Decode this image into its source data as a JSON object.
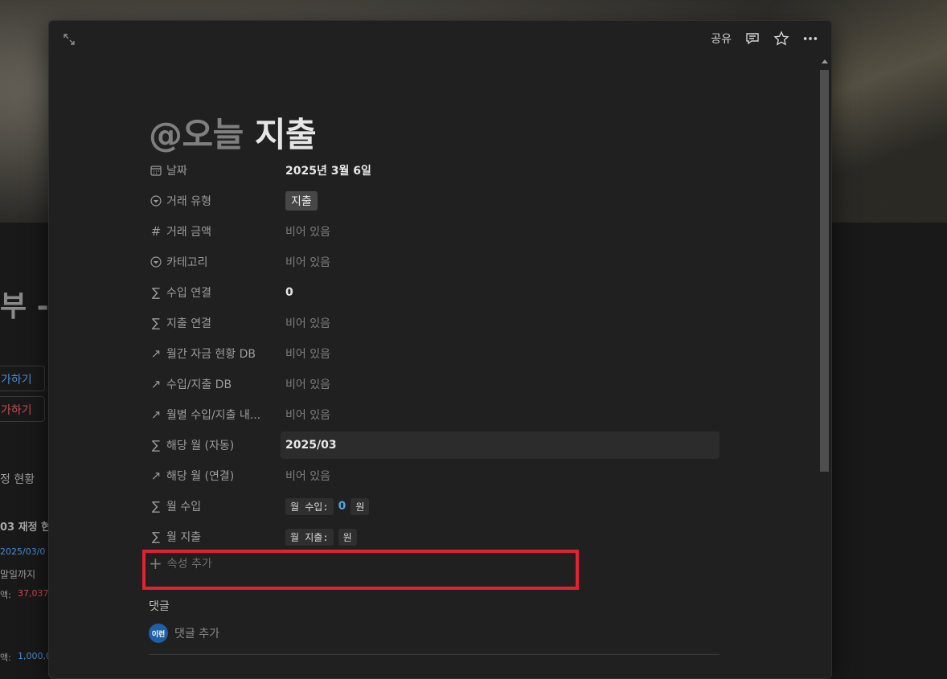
{
  "background": {
    "title_fragment": "부 -",
    "btn1": "가하기",
    "btn2": "가하기",
    "section": "정 현황",
    "sub_section": "03 재정 현",
    "date_link": "2025/03/0",
    "until": "말일까지",
    "amount_label": "액:",
    "amount_value": "37,037",
    "amount2_label": "액:",
    "amount2_value": "1,000,0"
  },
  "topbar": {
    "share_label": "공유"
  },
  "page": {
    "title_mention": "@오늘",
    "title_text": " 지출"
  },
  "properties": [
    {
      "icon": "calendar-icon",
      "name": "날짜",
      "value": "2025년 3월 6일"
    },
    {
      "icon": "select-icon",
      "name": "거래 유형",
      "tag": "지출"
    },
    {
      "icon": "number-icon",
      "name": "거래 금액",
      "value": "비어 있음"
    },
    {
      "icon": "select-icon",
      "name": "카테고리",
      "value": "비어 있음"
    },
    {
      "icon": "formula-icon",
      "name": "수입 연결",
      "value": "0"
    },
    {
      "icon": "formula-icon",
      "name": "지출 연결",
      "value": "비어 있음"
    },
    {
      "icon": "relation-icon",
      "name": "월간 자금 현황 DB",
      "value": "비어 있음"
    },
    {
      "icon": "relation-icon",
      "name": "수입/지출 DB",
      "value": "비어 있음"
    },
    {
      "icon": "relation-icon",
      "name": "월별 수입/지출 내...",
      "value": "비어 있음"
    },
    {
      "icon": "formula-icon",
      "name": "해당 월 (자동)",
      "value": "2025/03"
    },
    {
      "icon": "relation-icon",
      "name": "해당 월 (연결)",
      "value": "비어 있음"
    },
    {
      "icon": "formula-icon",
      "name": "월 수입",
      "chip": "월 수입:",
      "num": "0",
      "unit": "원"
    },
    {
      "icon": "formula-icon",
      "name": "월 지출",
      "chip": "월 지출:",
      "unit": "원"
    }
  ],
  "add_property": "속성 추가",
  "comments": {
    "label": "댓글",
    "avatar_text": "이런",
    "add_label": "댓글 추가"
  },
  "colors": {
    "highlight_box": "#e0232e",
    "blue_number": "#4aa8e6",
    "avatar": "#1d5fa8"
  }
}
